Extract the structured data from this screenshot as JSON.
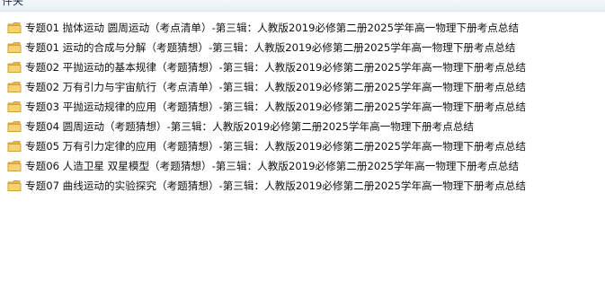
{
  "window": {
    "partial_title": "件夹"
  },
  "files": [
    {
      "icon": "folder-icon",
      "name": "专题01 抛体运动 圆周运动（考点清单）-第三辑：人教版2019必修第二册2025学年高一物理下册考点总结"
    },
    {
      "icon": "folder-icon",
      "name": "专题01 运动的合成与分解（考题猜想）-第三辑：人教版2019必修第二册2025学年高一物理下册考点总结"
    },
    {
      "icon": "folder-icon",
      "name": "专题02 平抛运动的基本规律（考题猜想）-第三辑：人教版2019必修第二册2025学年高一物理下册考点总结"
    },
    {
      "icon": "folder-icon",
      "name": "专题02 万有引力与宇宙航行（考点清单）-第三辑：人教版2019必修第二册2025学年高一物理下册考点总结"
    },
    {
      "icon": "folder-icon",
      "name": "专题03 平抛运动规律的应用（考题猜想）-第三辑：人教版2019必修第二册2025学年高一物理下册考点总结"
    },
    {
      "icon": "folder-icon",
      "name": "专题04 圆周运动（考题猜想）-第三辑：人教版2019必修第二册2025学年高一物理下册考点总结"
    },
    {
      "icon": "folder-icon",
      "name": "专题05 万有引力定律的应用（考题猜想）-第三辑：人教版2019必修第二册2025学年高一物理下册考点总结"
    },
    {
      "icon": "folder-icon",
      "name": "专题06 人造卫星 双星模型（考题猜想）-第三辑：人教版2019必修第二册2025学年高一物理下册考点总结"
    },
    {
      "icon": "folder-icon",
      "name": "专题07 曲线运动的实验探究（考题猜想）-第三辑：人教版2019必修第二册2025学年高一物理下册考点总结"
    }
  ],
  "colors": {
    "folder_body": "#e8b64a",
    "folder_front": "#f6d275",
    "folder_edge": "#c9952c"
  }
}
